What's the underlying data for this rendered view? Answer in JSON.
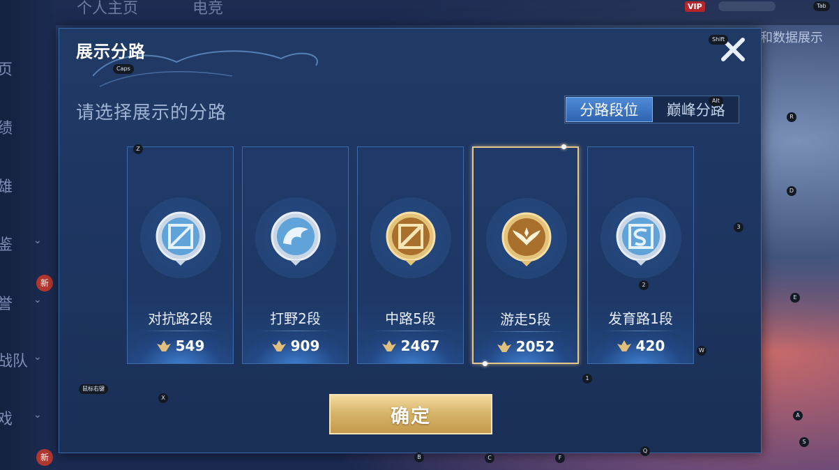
{
  "background": {
    "top_tabs": [
      "个人主页",
      "电竞"
    ],
    "vip": "VIP",
    "right_text": "和数据展示",
    "sidebar": [
      {
        "label": "页",
        "chevron": false
      },
      {
        "label": "绩",
        "chevron": false
      },
      {
        "label": "雄",
        "chevron": false
      },
      {
        "label": "鉴",
        "chevron": true
      },
      {
        "label": "誉",
        "chevron": true
      },
      {
        "label": "战队",
        "chevron": true
      },
      {
        "label": "戏",
        "chevron": true
      }
    ],
    "new_badge": "新"
  },
  "modal": {
    "title": "展示分路",
    "subtitle": "请选择展示的分路",
    "close_icon": "close-icon",
    "tabs": [
      {
        "label": "分路段位",
        "active": true
      },
      {
        "label": "巅峰分路",
        "active": false
      }
    ],
    "cards": [
      {
        "label": "对抗路2段",
        "score": "549",
        "icon": "clash-lane-badge-icon",
        "tier": "silver",
        "selected": false
      },
      {
        "label": "打野2段",
        "score": "909",
        "icon": "jungle-badge-icon",
        "tier": "silver",
        "selected": false
      },
      {
        "label": "中路5段",
        "score": "2467",
        "icon": "mid-lane-badge-icon",
        "tier": "gold",
        "selected": false
      },
      {
        "label": "游走5段",
        "score": "2052",
        "icon": "roam-badge-icon",
        "tier": "gold",
        "selected": true
      },
      {
        "label": "发育路1段",
        "score": "420",
        "icon": "farm-lane-badge-icon",
        "tier": "silver",
        "selected": false
      }
    ],
    "confirm_label": "确定"
  },
  "key_hints": {
    "tab": "Tab",
    "shift": "Shift",
    "caps": "Caps",
    "alt": "Alt",
    "z": "Z",
    "r": "R",
    "d": "D",
    "3": "3",
    "2": "2",
    "e": "E",
    "w": "W",
    "1": "1",
    "x": "X",
    "a": "A",
    "s": "S",
    "b": "B",
    "c": "C",
    "f": "F",
    "q": "Q",
    "right_click": "鼠标右键"
  },
  "colors": {
    "gold": "#d7b56c",
    "silver": "#9fb6d6",
    "selected_border": "#e8c88a",
    "active_tab": "#3d78c6"
  }
}
